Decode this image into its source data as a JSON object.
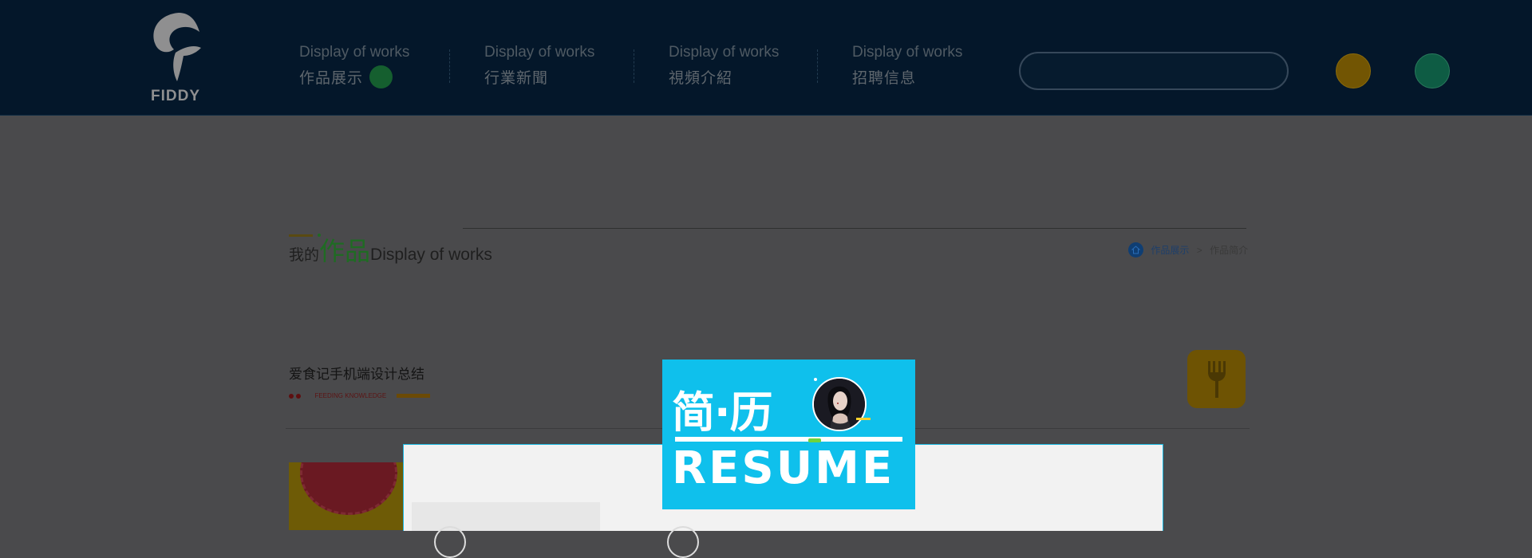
{
  "header": {
    "logo_text": "FIDDY",
    "nav": [
      {
        "en": "Display of works",
        "cn": "作品展示",
        "active": true
      },
      {
        "en": "Display of works",
        "cn": "行業新聞",
        "active": false
      },
      {
        "en": "Display of works",
        "cn": "視頻介紹",
        "active": false
      },
      {
        "en": "Display of works",
        "cn": "招聘信息",
        "active": false
      }
    ],
    "search_placeholder": ""
  },
  "section": {
    "title_prefix": "我的",
    "title_main": "作品",
    "title_en": "Display of works",
    "breadcrumb": {
      "link": "作品展示",
      "separator": ">",
      "current": "作品简介"
    }
  },
  "article": {
    "title": "爱食记手机端设计总结",
    "tag_text": "FEEDING KNOWLEDGE"
  },
  "resume_card": {
    "title_cn": "简·历",
    "title_en": "RESUME"
  },
  "colors": {
    "header_bg": "#04172a",
    "overlay_bg": "#4a4a4c",
    "resume_blue": "#0fc0ec",
    "accent_green": "#1f6b23"
  }
}
